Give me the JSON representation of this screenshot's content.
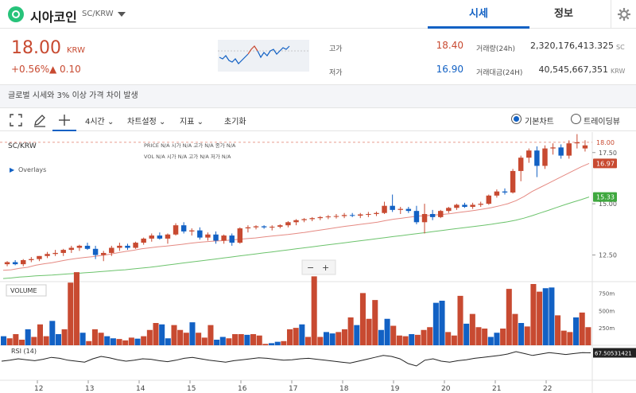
{
  "header": {
    "coin_name": "시아코인",
    "pair": "SC/KRW",
    "tabs": [
      {
        "label": "시세",
        "active": true
      },
      {
        "label": "정보",
        "active": false
      }
    ]
  },
  "price": {
    "current": "18.00",
    "unit": "KRW",
    "change_pct": "+0.56%",
    "change_abs": "▲ 0.10",
    "high_label": "고가",
    "high": "18.40",
    "low_label": "저가",
    "low": "16.90",
    "volume_label": "거래량(24h)",
    "volume": "2,320,176,413.325",
    "volume_unit": "SC",
    "amount_label": "거래대금(24H)",
    "amount": "40,545,667,351",
    "amount_unit": "KRW"
  },
  "notice": "글로벌 시세와 3% 이상 가격 차이 발생",
  "toolbar": {
    "interval": "4시간",
    "chart_settings": "차트설정",
    "indicators": "지표",
    "reset": "초기화",
    "basic_chart": "기본차트",
    "trading_view": "트레이딩뷰"
  },
  "colors": {
    "up": "#c84a31",
    "down": "#1261c4",
    "accent": "#1261c4",
    "ma_short": "#e58a83",
    "ma_long": "#6cc36c"
  },
  "chart_data": {
    "type": "candlestick",
    "symbol": "SC/KRW",
    "overlays_label": "Overlays",
    "legend": {
      "price": "PRICE",
      "open": "시가",
      "high": "고가",
      "low": "저가",
      "close": "종가",
      "vol": "VOL",
      "na": "N/A"
    },
    "price_axis_ticks": [
      "17.50",
      "15.00",
      "12.50"
    ],
    "price_range": [
      11.2,
      18.5
    ],
    "price_labels": {
      "current": "18.00",
      "ma_short": "16.97",
      "ma_long": "15.33"
    },
    "volume_label": "VOLUME",
    "volume_ticks": [
      "750m",
      "500m",
      "250m"
    ],
    "volume_range": [
      0,
      800
    ],
    "rsi_label": "RSI (14)",
    "rsi_value": "67.50531421",
    "x_ticks": [
      "12",
      "13",
      "14",
      "15",
      "16",
      "17",
      "18",
      "19",
      "20",
      "21",
      "22"
    ],
    "candles": [
      [
        12.05,
        12.2,
        11.95,
        12.15
      ],
      [
        12.15,
        12.25,
        12.0,
        12.05
      ],
      [
        12.05,
        12.3,
        11.95,
        12.25
      ],
      [
        12.25,
        12.4,
        12.15,
        12.3
      ],
      [
        12.3,
        12.45,
        12.2,
        12.45
      ],
      [
        12.45,
        12.65,
        12.35,
        12.55
      ],
      [
        12.55,
        12.75,
        12.45,
        12.6
      ],
      [
        12.6,
        12.8,
        12.45,
        12.75
      ],
      [
        12.75,
        12.95,
        12.6,
        12.85
      ],
      [
        12.85,
        13.0,
        12.7,
        12.95
      ],
      [
        12.95,
        13.1,
        12.75,
        12.8
      ],
      [
        12.8,
        12.95,
        12.3,
        12.5
      ],
      [
        12.5,
        12.7,
        12.2,
        12.6
      ],
      [
        12.6,
        12.95,
        12.45,
        12.85
      ],
      [
        12.85,
        13.1,
        12.7,
        12.95
      ],
      [
        12.95,
        13.05,
        12.75,
        12.85
      ],
      [
        12.85,
        13.15,
        12.8,
        13.1
      ],
      [
        13.1,
        13.35,
        13.0,
        13.3
      ],
      [
        13.3,
        13.55,
        13.15,
        13.45
      ],
      [
        13.45,
        13.6,
        13.25,
        13.3
      ],
      [
        13.3,
        13.55,
        13.05,
        13.5
      ],
      [
        13.5,
        14.05,
        13.45,
        13.95
      ],
      [
        13.95,
        14.1,
        13.55,
        13.65
      ],
      [
        13.65,
        13.8,
        13.45,
        13.7
      ],
      [
        13.7,
        13.85,
        13.25,
        13.35
      ],
      [
        13.35,
        13.6,
        13.2,
        13.5
      ],
      [
        13.5,
        13.65,
        13.05,
        13.2
      ],
      [
        13.2,
        13.5,
        13.05,
        13.45
      ],
      [
        13.45,
        13.55,
        12.95,
        13.1
      ],
      [
        13.1,
        13.85,
        13.05,
        13.8
      ],
      [
        13.8,
        13.95,
        13.6,
        13.85
      ],
      [
        13.85,
        13.95,
        13.75,
        13.9
      ],
      [
        13.9,
        13.95,
        13.78,
        13.85
      ],
      [
        13.85,
        13.95,
        13.7,
        13.88
      ],
      [
        13.88,
        14.0,
        13.8,
        13.95
      ],
      [
        13.95,
        14.15,
        13.85,
        14.1
      ],
      [
        14.1,
        14.25,
        13.95,
        14.2
      ],
      [
        14.2,
        14.3,
        14.1,
        14.25
      ],
      [
        14.25,
        14.35,
        14.15,
        14.3
      ],
      [
        14.3,
        14.4,
        14.2,
        14.35
      ],
      [
        14.35,
        14.45,
        14.25,
        14.38
      ],
      [
        14.38,
        14.5,
        14.28,
        14.4
      ],
      [
        14.4,
        14.55,
        14.3,
        14.45
      ],
      [
        14.45,
        14.55,
        14.35,
        14.42
      ],
      [
        14.42,
        14.55,
        14.3,
        14.48
      ],
      [
        14.48,
        14.6,
        14.35,
        14.5
      ],
      [
        14.5,
        14.62,
        14.4,
        14.55
      ],
      [
        14.55,
        15.1,
        14.5,
        14.9
      ],
      [
        14.9,
        15.45,
        14.6,
        14.7
      ],
      [
        14.7,
        14.85,
        14.5,
        14.75
      ],
      [
        14.75,
        14.85,
        14.55,
        14.65
      ],
      [
        14.65,
        14.9,
        14.0,
        14.1
      ],
      [
        14.1,
        15.0,
        13.55,
        14.5
      ],
      [
        14.5,
        14.7,
        14.2,
        14.35
      ],
      [
        14.35,
        14.7,
        14.3,
        14.65
      ],
      [
        14.65,
        14.85,
        14.55,
        14.8
      ],
      [
        14.8,
        15.0,
        14.7,
        14.95
      ],
      [
        14.95,
        15.05,
        14.8,
        14.85
      ],
      [
        14.85,
        15.05,
        14.75,
        14.95
      ],
      [
        14.95,
        15.1,
        14.85,
        15.0
      ],
      [
        15.0,
        15.45,
        14.95,
        15.4
      ],
      [
        15.4,
        15.7,
        15.3,
        15.6
      ],
      [
        15.6,
        15.75,
        15.45,
        15.55
      ],
      [
        15.55,
        16.7,
        15.5,
        16.6
      ],
      [
        16.6,
        17.35,
        16.1,
        17.25
      ],
      [
        17.25,
        17.7,
        17.0,
        17.6
      ],
      [
        17.6,
        17.8,
        16.3,
        16.85
      ],
      [
        16.85,
        17.85,
        16.7,
        17.7
      ],
      [
        17.7,
        17.95,
        17.4,
        17.75
      ],
      [
        17.75,
        17.9,
        17.2,
        17.35
      ],
      [
        17.35,
        18.1,
        17.2,
        17.95
      ],
      [
        17.95,
        18.4,
        17.7,
        18.0
      ],
      [
        17.7,
        18.1,
        17.55,
        17.85
      ]
    ],
    "volumes": [
      130,
      100,
      160,
      80,
      230,
      120,
      300,
      130,
      350,
      160,
      230,
      900,
      1050,
      180,
      60,
      230,
      180,
      130,
      100,
      90,
      70,
      110,
      95,
      130,
      220,
      320,
      300,
      100,
      290,
      220,
      180,
      330,
      180,
      110,
      290,
      80,
      120,
      100,
      160,
      160,
      150,
      160,
      140,
      20,
      30,
      50,
      60,
      230,
      250,
      300,
      120,
      990,
      120,
      190,
      170,
      190,
      230,
      400,
      290,
      750,
      380,
      650,
      220,
      380,
      280,
      140,
      130,
      160,
      150,
      220,
      260,
      610,
      640,
      190,
      140,
      710,
      310,
      450,
      260,
      240,
      120,
      180,
      240,
      810,
      450,
      320,
      270,
      880,
      770,
      820,
      830,
      430,
      210,
      190,
      400,
      470,
      260
    ],
    "ma_short": [
      11.75,
      11.78,
      11.85,
      11.9,
      12.0,
      12.07,
      12.12,
      12.2,
      12.27,
      12.33,
      12.38,
      12.42,
      12.47,
      12.53,
      12.6,
      12.67,
      12.73,
      12.8,
      12.85,
      12.9,
      12.93,
      12.98,
      13.02,
      13.07,
      13.12,
      13.15,
      13.18,
      13.2,
      13.23,
      13.27,
      13.3,
      13.33,
      13.38,
      13.42,
      13.46,
      13.5,
      13.55,
      13.6,
      13.66,
      13.72,
      13.78,
      13.84,
      13.9,
      13.95,
      14.0,
      14.05,
      14.1,
      14.18,
      14.25,
      14.3,
      14.35,
      14.4,
      14.42,
      14.45,
      14.48,
      14.52,
      14.58,
      14.63,
      14.68,
      14.74,
      14.81,
      14.9,
      15.0,
      15.15,
      15.35,
      15.6,
      15.8,
      16.0,
      16.2,
      16.4,
      16.6,
      16.8,
      16.97
    ],
    "ma_long": [
      11.35,
      11.38,
      11.42,
      11.45,
      11.48,
      11.5,
      11.52,
      11.55,
      11.58,
      11.6,
      11.63,
      11.66,
      11.69,
      11.72,
      11.75,
      11.78,
      11.82,
      11.86,
      11.9,
      11.95,
      12.0,
      12.05,
      12.1,
      12.15,
      12.2,
      12.25,
      12.3,
      12.35,
      12.4,
      12.45,
      12.5,
      12.55,
      12.6,
      12.65,
      12.7,
      12.75,
      12.8,
      12.85,
      12.9,
      12.95,
      13.0,
      13.05,
      13.1,
      13.15,
      13.2,
      13.25,
      13.3,
      13.35,
      13.4,
      13.45,
      13.5,
      13.55,
      13.6,
      13.65,
      13.7,
      13.75,
      13.8,
      13.85,
      13.9,
      13.95,
      14.0,
      14.06,
      14.12,
      14.2,
      14.3,
      14.42,
      14.55,
      14.68,
      14.82,
      14.95,
      15.08,
      15.2,
      15.33
    ],
    "rsi": [
      50,
      52,
      55,
      53,
      51,
      54,
      58,
      56,
      52,
      50,
      48,
      55,
      60,
      57,
      53,
      50,
      52,
      55,
      54,
      51,
      49,
      52,
      56,
      58,
      55,
      52,
      50,
      48,
      51,
      53,
      55,
      57,
      56,
      54,
      52,
      53,
      55,
      56,
      54,
      52,
      50,
      48,
      46,
      50,
      54,
      58,
      62,
      60,
      55,
      45,
      40,
      52,
      55,
      50,
      48,
      51,
      53,
      56,
      58,
      60,
      62,
      65,
      70,
      66,
      62,
      65,
      68,
      66,
      64,
      66,
      68,
      67.5
    ]
  }
}
